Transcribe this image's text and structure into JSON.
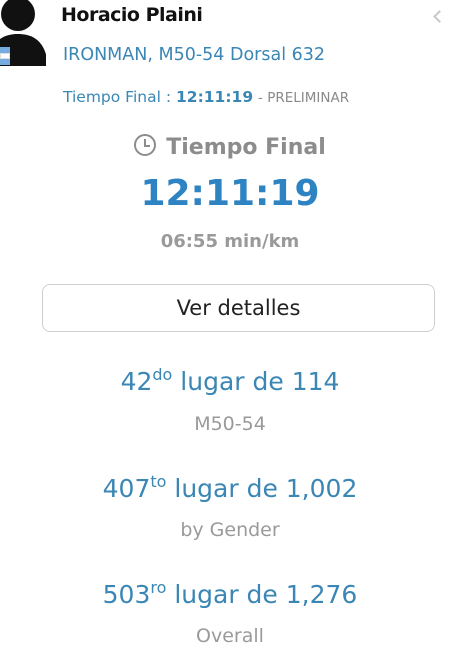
{
  "athlete": {
    "name": "Horacio Plaini",
    "division": "IRONMAN, M50-54 Dorsal 632"
  },
  "summary": {
    "label": "Tiempo Final :",
    "time": "12:11:19",
    "status": "- PRELIMINAR"
  },
  "main": {
    "title": "Tiempo Final",
    "time": "12:11:19",
    "pace": "06:55 min/km",
    "details_button": "Ver detalles"
  },
  "ranks": [
    {
      "position": "42",
      "suffix": "do",
      "of_text": "lugar de 114",
      "category": "M50-54"
    },
    {
      "position": "407",
      "suffix": "to",
      "of_text": "lugar de 1,002",
      "category": "by Gender"
    },
    {
      "position": "503",
      "suffix": "ro",
      "of_text": "lugar de 1,276",
      "category": "Overall"
    }
  ],
  "colors": {
    "accent": "#3a86b4",
    "time_accent": "#2e83c2",
    "muted": "#9a9a9a"
  },
  "icons": [
    "avatar",
    "flag-icon",
    "chevron-left-icon",
    "clock-icon"
  ]
}
